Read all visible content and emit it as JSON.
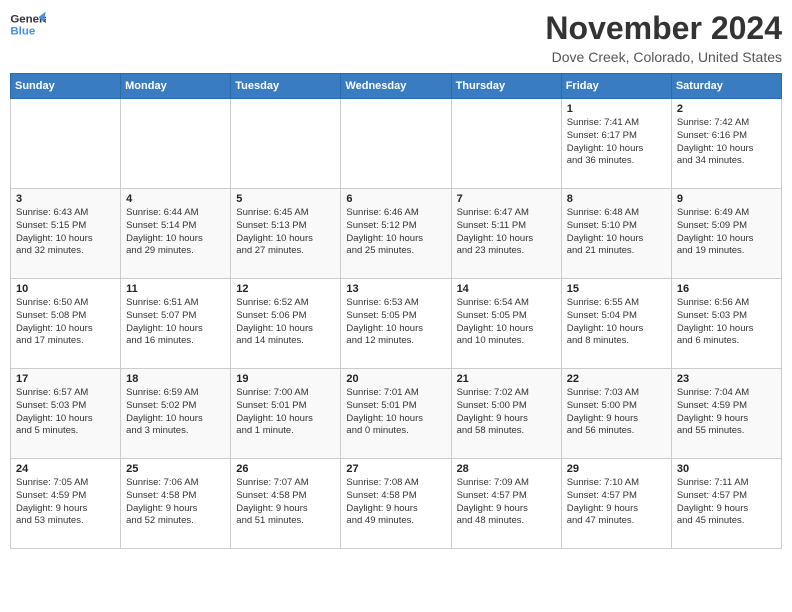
{
  "header": {
    "logo_line1": "General",
    "logo_line2": "Blue",
    "month": "November 2024",
    "location": "Dove Creek, Colorado, United States"
  },
  "weekdays": [
    "Sunday",
    "Monday",
    "Tuesday",
    "Wednesday",
    "Thursday",
    "Friday",
    "Saturday"
  ],
  "weeks": [
    [
      {
        "day": "",
        "info": ""
      },
      {
        "day": "",
        "info": ""
      },
      {
        "day": "",
        "info": ""
      },
      {
        "day": "",
        "info": ""
      },
      {
        "day": "",
        "info": ""
      },
      {
        "day": "1",
        "info": "Sunrise: 7:41 AM\nSunset: 6:17 PM\nDaylight: 10 hours\nand 36 minutes."
      },
      {
        "day": "2",
        "info": "Sunrise: 7:42 AM\nSunset: 6:16 PM\nDaylight: 10 hours\nand 34 minutes."
      }
    ],
    [
      {
        "day": "3",
        "info": "Sunrise: 6:43 AM\nSunset: 5:15 PM\nDaylight: 10 hours\nand 32 minutes."
      },
      {
        "day": "4",
        "info": "Sunrise: 6:44 AM\nSunset: 5:14 PM\nDaylight: 10 hours\nand 29 minutes."
      },
      {
        "day": "5",
        "info": "Sunrise: 6:45 AM\nSunset: 5:13 PM\nDaylight: 10 hours\nand 27 minutes."
      },
      {
        "day": "6",
        "info": "Sunrise: 6:46 AM\nSunset: 5:12 PM\nDaylight: 10 hours\nand 25 minutes."
      },
      {
        "day": "7",
        "info": "Sunrise: 6:47 AM\nSunset: 5:11 PM\nDaylight: 10 hours\nand 23 minutes."
      },
      {
        "day": "8",
        "info": "Sunrise: 6:48 AM\nSunset: 5:10 PM\nDaylight: 10 hours\nand 21 minutes."
      },
      {
        "day": "9",
        "info": "Sunrise: 6:49 AM\nSunset: 5:09 PM\nDaylight: 10 hours\nand 19 minutes."
      }
    ],
    [
      {
        "day": "10",
        "info": "Sunrise: 6:50 AM\nSunset: 5:08 PM\nDaylight: 10 hours\nand 17 minutes."
      },
      {
        "day": "11",
        "info": "Sunrise: 6:51 AM\nSunset: 5:07 PM\nDaylight: 10 hours\nand 16 minutes."
      },
      {
        "day": "12",
        "info": "Sunrise: 6:52 AM\nSunset: 5:06 PM\nDaylight: 10 hours\nand 14 minutes."
      },
      {
        "day": "13",
        "info": "Sunrise: 6:53 AM\nSunset: 5:05 PM\nDaylight: 10 hours\nand 12 minutes."
      },
      {
        "day": "14",
        "info": "Sunrise: 6:54 AM\nSunset: 5:05 PM\nDaylight: 10 hours\nand 10 minutes."
      },
      {
        "day": "15",
        "info": "Sunrise: 6:55 AM\nSunset: 5:04 PM\nDaylight: 10 hours\nand 8 minutes."
      },
      {
        "day": "16",
        "info": "Sunrise: 6:56 AM\nSunset: 5:03 PM\nDaylight: 10 hours\nand 6 minutes."
      }
    ],
    [
      {
        "day": "17",
        "info": "Sunrise: 6:57 AM\nSunset: 5:03 PM\nDaylight: 10 hours\nand 5 minutes."
      },
      {
        "day": "18",
        "info": "Sunrise: 6:59 AM\nSunset: 5:02 PM\nDaylight: 10 hours\nand 3 minutes."
      },
      {
        "day": "19",
        "info": "Sunrise: 7:00 AM\nSunset: 5:01 PM\nDaylight: 10 hours\nand 1 minute."
      },
      {
        "day": "20",
        "info": "Sunrise: 7:01 AM\nSunset: 5:01 PM\nDaylight: 10 hours\nand 0 minutes."
      },
      {
        "day": "21",
        "info": "Sunrise: 7:02 AM\nSunset: 5:00 PM\nDaylight: 9 hours\nand 58 minutes."
      },
      {
        "day": "22",
        "info": "Sunrise: 7:03 AM\nSunset: 5:00 PM\nDaylight: 9 hours\nand 56 minutes."
      },
      {
        "day": "23",
        "info": "Sunrise: 7:04 AM\nSunset: 4:59 PM\nDaylight: 9 hours\nand 55 minutes."
      }
    ],
    [
      {
        "day": "24",
        "info": "Sunrise: 7:05 AM\nSunset: 4:59 PM\nDaylight: 9 hours\nand 53 minutes."
      },
      {
        "day": "25",
        "info": "Sunrise: 7:06 AM\nSunset: 4:58 PM\nDaylight: 9 hours\nand 52 minutes."
      },
      {
        "day": "26",
        "info": "Sunrise: 7:07 AM\nSunset: 4:58 PM\nDaylight: 9 hours\nand 51 minutes."
      },
      {
        "day": "27",
        "info": "Sunrise: 7:08 AM\nSunset: 4:58 PM\nDaylight: 9 hours\nand 49 minutes."
      },
      {
        "day": "28",
        "info": "Sunrise: 7:09 AM\nSunset: 4:57 PM\nDaylight: 9 hours\nand 48 minutes."
      },
      {
        "day": "29",
        "info": "Sunrise: 7:10 AM\nSunset: 4:57 PM\nDaylight: 9 hours\nand 47 minutes."
      },
      {
        "day": "30",
        "info": "Sunrise: 7:11 AM\nSunset: 4:57 PM\nDaylight: 9 hours\nand 45 minutes."
      }
    ]
  ]
}
